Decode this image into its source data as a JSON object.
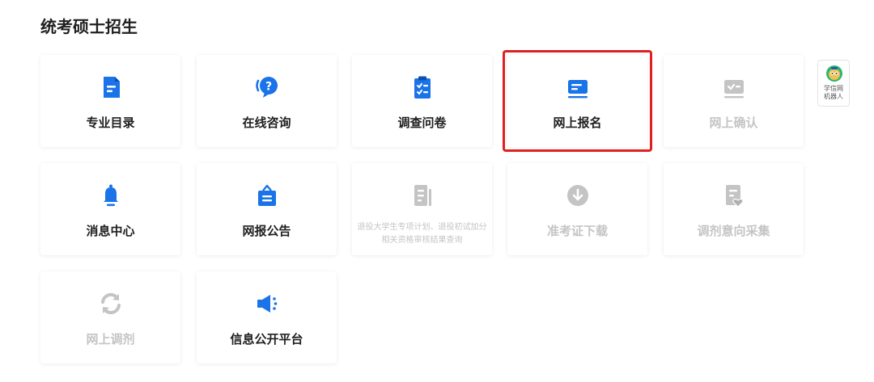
{
  "section": {
    "title": "统考硕士招生"
  },
  "colors": {
    "accent": "#1a73e8",
    "disabled": "#c4c4c4",
    "highlight": "#e02020"
  },
  "tiles": [
    {
      "label": "专业目录",
      "icon": "document-list-icon",
      "enabled": true
    },
    {
      "label": "在线咨询",
      "icon": "chat-question-icon",
      "enabled": true
    },
    {
      "label": "调查问卷",
      "icon": "clipboard-checklist-icon",
      "enabled": true
    },
    {
      "label": "网上报名",
      "icon": "id-card-icon",
      "enabled": true,
      "highlighted": true
    },
    {
      "label": "网上确认",
      "icon": "confirm-card-icon",
      "enabled": false
    },
    {
      "label": "消息中心",
      "icon": "bell-icon",
      "enabled": true
    },
    {
      "label": "网报公告",
      "icon": "bulletin-bag-icon",
      "enabled": true
    },
    {
      "label": "退役大学生专项计划、退役初试加分相关资格审核结果查询",
      "icon": "document-lines-icon",
      "enabled": false
    },
    {
      "label": "准考证下载",
      "icon": "download-circle-icon",
      "enabled": false
    },
    {
      "label": "调剂意向采集",
      "icon": "form-heart-icon",
      "enabled": false
    },
    {
      "label": "网上调剂",
      "icon": "refresh-cycle-icon",
      "enabled": false
    },
    {
      "label": "信息公开平台",
      "icon": "megaphone-icon",
      "enabled": true
    }
  ],
  "robot": {
    "label": "学信网机器人",
    "icon": "robot-avatar-icon"
  }
}
